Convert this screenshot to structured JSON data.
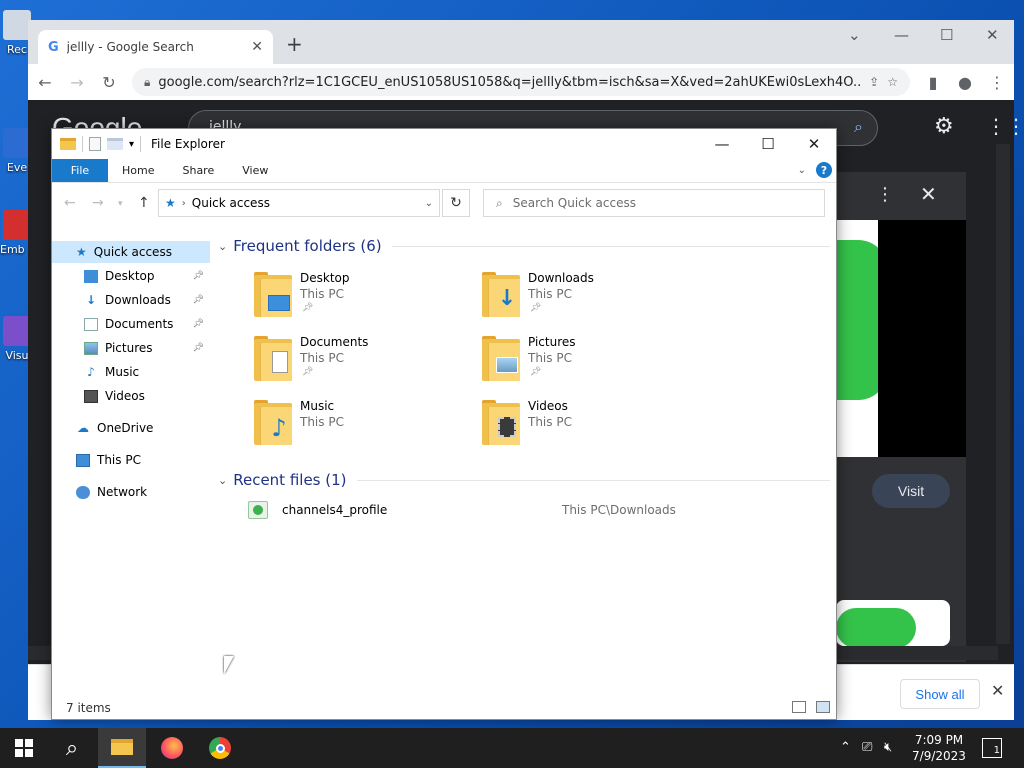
{
  "desktop": {
    "icons": [
      {
        "label": "Rec"
      },
      {
        "label": "Eve"
      },
      {
        "label": "Emb De"
      },
      {
        "label": "Visu"
      }
    ]
  },
  "chrome": {
    "tab_title": "jellly - Google Search",
    "url": "google.com/search?rlz=1C1GCEU_enUS1058US1058&q=jellly&tbm=isch&sa=X&ved=2ahUKEwi0sLexh4O...",
    "logo_text": "Google",
    "search_query": "jellly",
    "visit_label": "Visit",
    "show_all_label": "Show all"
  },
  "explorer": {
    "title": "File Explorer",
    "ribbon_tabs": [
      "File",
      "Home",
      "Share",
      "View"
    ],
    "breadcrumb": "Quick access",
    "search_placeholder": "Search Quick access",
    "nav": {
      "quick_access": "Quick access",
      "pinned": [
        "Desktop",
        "Downloads",
        "Documents",
        "Pictures",
        "Music",
        "Videos"
      ],
      "onedrive": "OneDrive",
      "this_pc": "This PC",
      "network": "Network"
    },
    "frequent_header": "Frequent folders (6)",
    "folders": [
      {
        "name": "Desktop",
        "location": "This PC",
        "pinned": true
      },
      {
        "name": "Downloads",
        "location": "This PC",
        "pinned": true
      },
      {
        "name": "Documents",
        "location": "This PC",
        "pinned": true
      },
      {
        "name": "Pictures",
        "location": "This PC",
        "pinned": true
      },
      {
        "name": "Music",
        "location": "This PC",
        "pinned": false
      },
      {
        "name": "Videos",
        "location": "This PC",
        "pinned": false
      }
    ],
    "recent_header": "Recent files (1)",
    "recent_files": [
      {
        "name": "channels4_profile",
        "path": "This PC\\Downloads"
      }
    ],
    "status": "7 items"
  },
  "taskbar": {
    "time": "7:09 PM",
    "date": "7/9/2023",
    "notification_count": "1"
  },
  "colors": {
    "accent": "#1979ca",
    "selection": "#cce8ff",
    "group_header": "#1e3287"
  }
}
